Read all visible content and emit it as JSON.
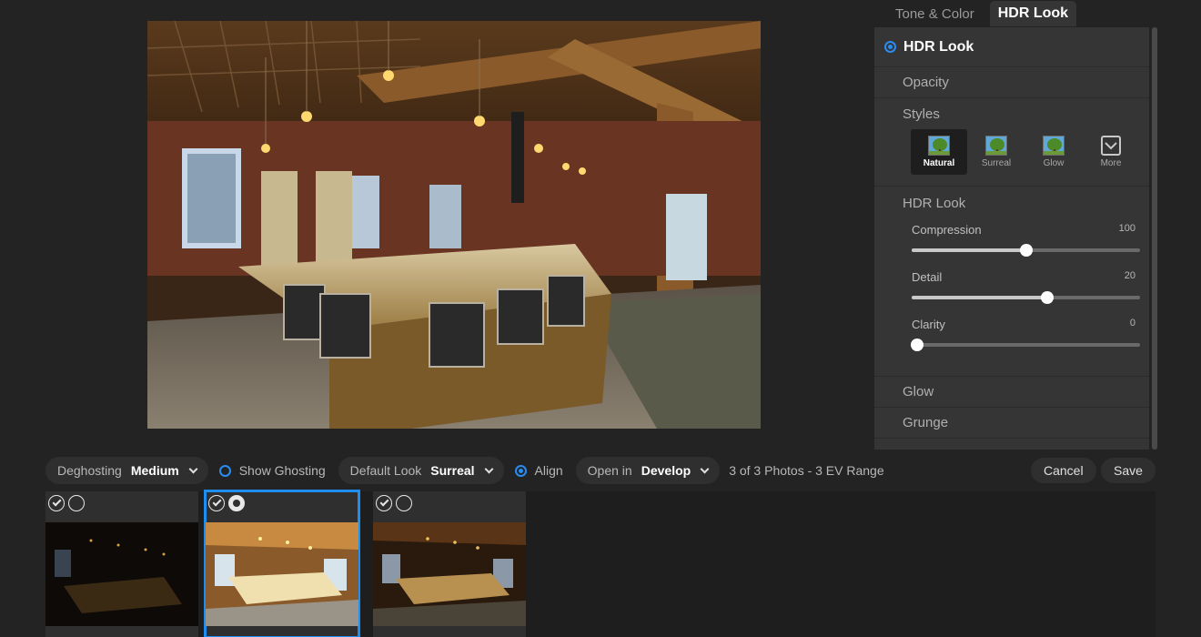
{
  "panel": {
    "tabs": [
      {
        "label": "Tone & Color",
        "active": false
      },
      {
        "label": "HDR Look",
        "active": true
      }
    ],
    "header_title": "HDR Look",
    "sections": {
      "opacity": "Opacity",
      "styles": "Styles",
      "hdr_look": "HDR Look",
      "glow": "Glow",
      "grunge": "Grunge"
    },
    "styles": [
      {
        "label": "Natural",
        "selected": true
      },
      {
        "label": "Surreal",
        "selected": false
      },
      {
        "label": "Glow",
        "selected": false
      },
      {
        "label": "More",
        "selected": false
      }
    ],
    "sliders": [
      {
        "label": "Compression",
        "value": "100",
        "position": 0.5
      },
      {
        "label": "Detail",
        "value": "20",
        "position": 0.595
      },
      {
        "label": "Clarity",
        "value": "0",
        "position": 0.025
      }
    ]
  },
  "toolbar": {
    "deghosting_label": "Deghosting",
    "deghosting_value": "Medium",
    "show_ghosting_label": "Show Ghosting",
    "default_look_label": "Default Look",
    "default_look_value": "Surreal",
    "align_label": "Align",
    "open_in_label": "Open in",
    "open_in_value": "Develop",
    "photo_count": "3 of 3 Photos - 3 EV Range",
    "cancel_label": "Cancel",
    "save_label": "Save"
  },
  "filmstrip": {
    "selected_index": 1,
    "frame_count": 3
  },
  "colors": {
    "accent": "#1e8ef0",
    "panel_bg": "#353535",
    "app_bg": "#232323"
  }
}
